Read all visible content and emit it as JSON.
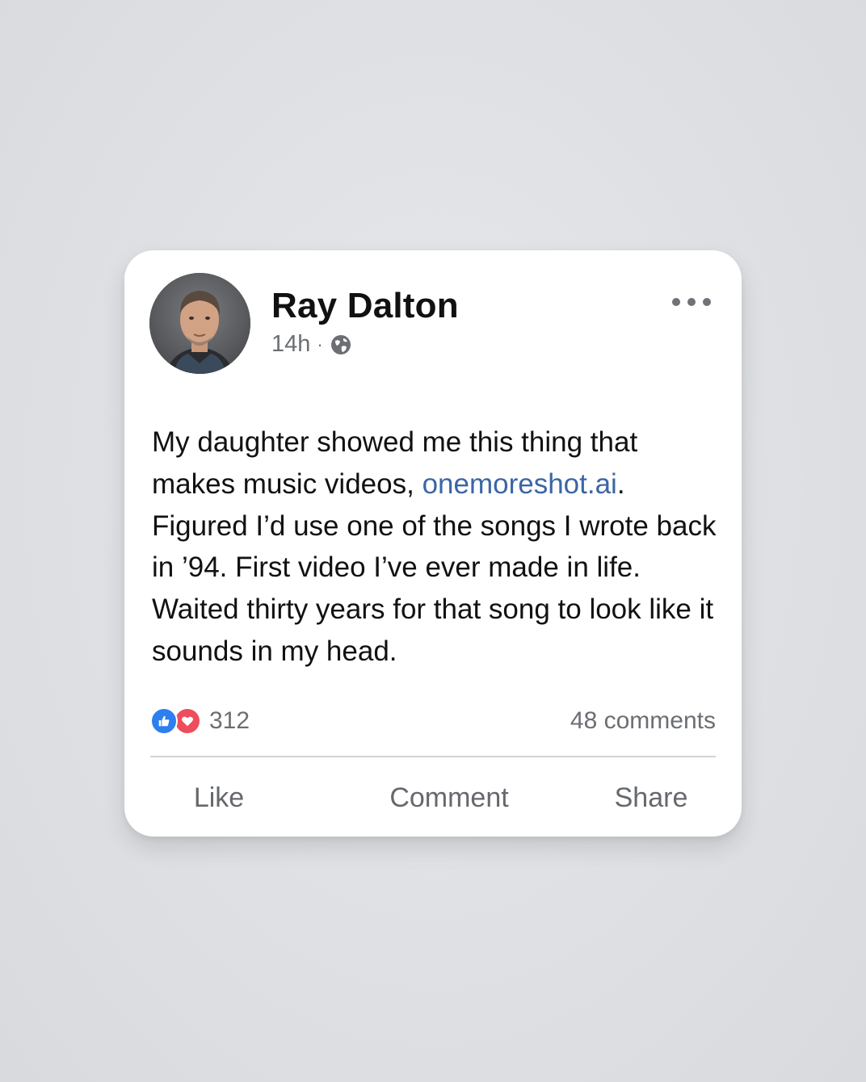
{
  "post": {
    "author": "Ray Dalton",
    "time": "14h",
    "separator": "·",
    "audience_icon": "globe-icon",
    "more_icon": "more-options-icon",
    "text_before_link": "My daughter showed me this thing that makes music videos, ",
    "link_text": "onemoreshot.ai",
    "text_after_link": ". Figured I’d use one of the songs I wrote back in ’94. First video I’ve ever made in life. Waited thirty years for that song to look like it sounds in my head."
  },
  "stats": {
    "reaction_icons": [
      "like-reaction-icon",
      "love-reaction-icon"
    ],
    "reaction_count": "312",
    "comments": "48 comments"
  },
  "actions": {
    "like": "Like",
    "comment": "Comment",
    "share": "Share"
  },
  "colors": {
    "link": "#3b66a5",
    "like_blue": "#2d7ff0",
    "love_red": "#ef4c5c",
    "muted_text": "#6b6e73"
  }
}
